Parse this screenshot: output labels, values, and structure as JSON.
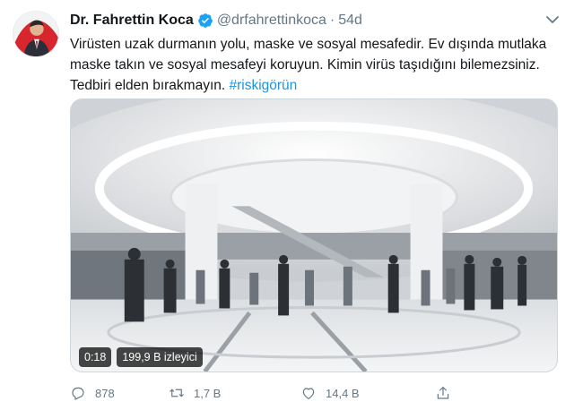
{
  "tweet": {
    "author_name": "Dr. Fahrettin Koca",
    "verified_icon": "verified-badge-icon",
    "handle": "@drfahrettinkoca",
    "separator": "·",
    "time": "54d",
    "text_main": "Virüsten uzak durmanın yolu, maske ve sosyal mesafedir. Ev dışında mutlaka maske takın ve sosyal mesafeyi koruyun. Kimin virüs taşıdığını bilemezsiniz. Tedbiri elden bırakmayın. ",
    "hashtag": "#riskigörün",
    "colors": {
      "accent": "#1b95e0",
      "verified": "#1da1f2",
      "muted": "#657786"
    }
  },
  "video": {
    "duration": "0:18",
    "views": "199,9 B izleyici"
  },
  "actions": {
    "reply_count": "878",
    "retweet_count": "1,7 B",
    "like_count": "14,4 B",
    "reply_icon": "reply-icon",
    "retweet_icon": "retweet-icon",
    "like_icon": "heart-icon",
    "share_icon": "share-icon"
  }
}
